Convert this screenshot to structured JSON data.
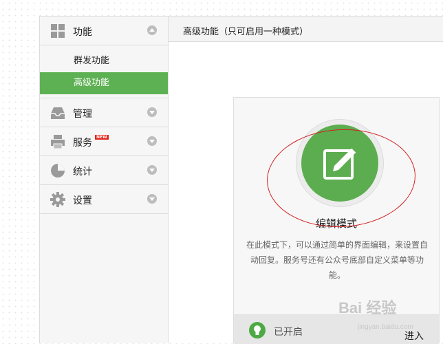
{
  "sidebar": {
    "sections": [
      {
        "label": "功能",
        "icon": "grid-icon",
        "arrow": "up"
      },
      {
        "label": "管理",
        "icon": "inbox-icon",
        "arrow": "down"
      },
      {
        "label": "服务",
        "icon": "printer-icon",
        "arrow": "down",
        "badge": "NEW"
      },
      {
        "label": "统计",
        "icon": "pie-chart-icon",
        "arrow": "down"
      },
      {
        "label": "设置",
        "icon": "gear-icon",
        "arrow": "down"
      }
    ],
    "sub_items": [
      {
        "label": "群发功能",
        "active": false
      },
      {
        "label": "高级功能",
        "active": true
      }
    ]
  },
  "header": {
    "title": "高级功能（只可启用一种模式）"
  },
  "card": {
    "icon": "edit-icon",
    "title": "编辑模式",
    "description": "在此模式下，可以通过简单的界面编辑，来设置自动回复。服务号还有公众号底部自定义菜单等功能。",
    "status": "已开启",
    "status_icon": "lightbulb-icon",
    "enter_label": "进入"
  },
  "watermark": {
    "text": "Bai 经验",
    "sub": "jingyan.baidu.com"
  },
  "colors": {
    "accent_green": "#5eb153",
    "annotation_red": "#d32020"
  }
}
